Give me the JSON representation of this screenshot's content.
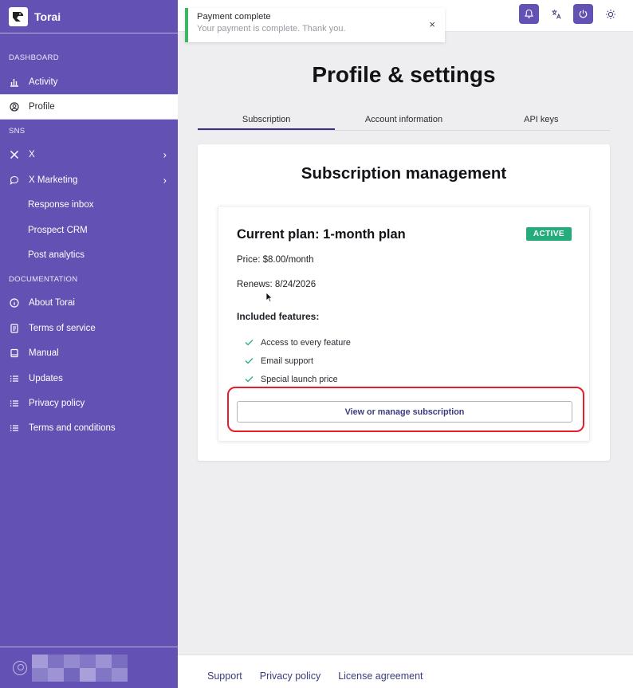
{
  "app": {
    "name": "Torai"
  },
  "sidebar": {
    "sections": [
      {
        "label": "DASHBOARD"
      },
      {
        "label": "SNS"
      },
      {
        "label": "DOCUMENTATION"
      }
    ],
    "items": [
      {
        "label": "Activity",
        "icon": "bar-chart-icon"
      },
      {
        "label": "Profile",
        "icon": "user-circle-icon",
        "active": true
      },
      {
        "label": "X",
        "icon": "x-logo-icon",
        "chevron": true
      },
      {
        "label": "X Marketing",
        "icon": "chat-bubble-icon",
        "chevron": true
      },
      {
        "label": "Response inbox"
      },
      {
        "label": "Prospect CRM"
      },
      {
        "label": "Post analytics"
      },
      {
        "label": "About Torai",
        "icon": "info-icon"
      },
      {
        "label": "Terms of service",
        "icon": "document-icon"
      },
      {
        "label": "Manual",
        "icon": "book-icon"
      },
      {
        "label": "Updates",
        "icon": "list-icon"
      },
      {
        "label": "Privacy policy",
        "icon": "list-icon"
      },
      {
        "label": "Terms and conditions",
        "icon": "list-icon"
      }
    ]
  },
  "toast": {
    "title": "Payment complete",
    "message": "Your payment is complete. Thank you.",
    "close_glyph": "×"
  },
  "header": {
    "icons": [
      "bell-icon",
      "translate-icon",
      "power-icon",
      "sun-icon"
    ]
  },
  "main": {
    "title": "Profile & settings",
    "tabs": [
      {
        "label": "Subscription",
        "active": true
      },
      {
        "label": "Account information"
      },
      {
        "label": "API keys"
      }
    ],
    "subscription": {
      "heading": "Subscription management",
      "plan_title": "Current plan: 1-month plan",
      "status": "ACTIVE",
      "price": "Price: $8.00/month",
      "renews": "Renews: 8/24/2026",
      "features_heading": "Included features:",
      "features": [
        "Access to every feature",
        "Email support",
        "Special launch price"
      ],
      "manage_button": "View or manage subscription"
    }
  },
  "footer": {
    "links": [
      "Support",
      "Privacy policy",
      "License agreement"
    ]
  },
  "colors": {
    "sidebar": "#6352b3",
    "accent": "#3b2f88",
    "active_badge": "#24ac7c",
    "toast_success": "#3cb567",
    "highlight": "#e41f2a"
  }
}
